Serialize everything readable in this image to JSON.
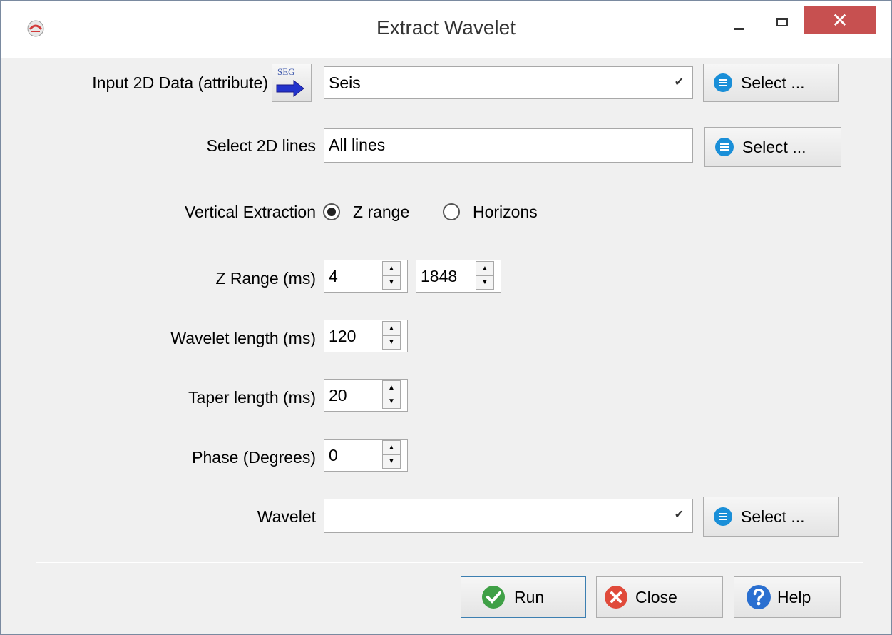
{
  "window": {
    "title": "Extract Wavelet",
    "close_glyph": "✕"
  },
  "input_data": {
    "label": "Input 2D Data (attribute)",
    "icon_text": "SEG",
    "value": "Seis",
    "select_label": "Select ..."
  },
  "lines": {
    "label": "Select 2D lines",
    "value": "All lines",
    "select_label": "Select ..."
  },
  "vertical_extraction": {
    "label": "Vertical Extraction",
    "options": [
      "Z range",
      "Horizons"
    ],
    "selected": "Z range"
  },
  "z_range": {
    "label": "Z Range  (ms)",
    "start": "4",
    "stop": "1848"
  },
  "wavelet_length": {
    "label": "Wavelet length (ms)",
    "value": "120"
  },
  "taper_length": {
    "label": "Taper length (ms)",
    "value": "20"
  },
  "phase": {
    "label": "Phase (Degrees)",
    "value": "0"
  },
  "wavelet": {
    "label": "Wavelet",
    "value": "",
    "select_label": "Select ..."
  },
  "buttons": {
    "run": "Run",
    "close": "Close",
    "help": "Help"
  },
  "colors": {
    "close_button": "#c75050",
    "list_icon": "#1a8fd8",
    "run_icon": "#3fa046",
    "close_icon": "#e04a3a",
    "help_icon": "#2a6fd0"
  }
}
